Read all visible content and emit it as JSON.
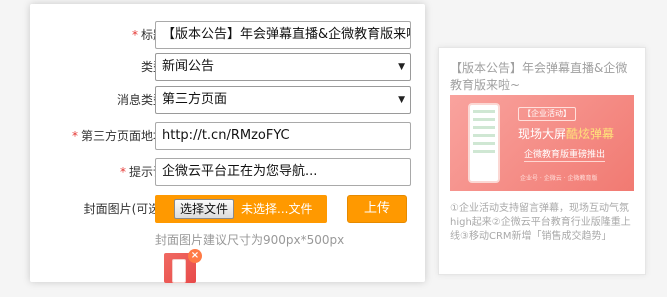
{
  "form": {
    "title": {
      "label": "标题：",
      "value": "【版本公告】年会弹幕直播&企微教育版来啦~"
    },
    "type": {
      "label": "类型：",
      "selected": "新闻公告"
    },
    "message_type": {
      "label": "消息类型：",
      "selected": "第三方页面"
    },
    "third_party_url": {
      "label": "第三方页面地址：",
      "value": "http://t.cn/RMzoFYC"
    },
    "prompt": {
      "label": "提示语：",
      "value": "企微云平台正在为您导航..."
    },
    "cover": {
      "label": "封面图片(可选)：",
      "choose_file": "选择文件",
      "no_file": "未选择...文件",
      "upload": "上传",
      "hint": "封面图片建议尺寸为900px*500px",
      "remove_icon": "close-icon"
    },
    "required_mark": "*"
  },
  "preview": {
    "title": "【版本公告】年会弹幕直播&企微教育版来啦~",
    "banner": {
      "tag": "【企业活动】",
      "main_prefix": "现场大屏",
      "main_highlight": "酷炫弹幕",
      "sub": "企微教育版重磅推出",
      "foot": "企业号 · 企微云 · 企微教育版"
    },
    "description": "①企业活动支持留言弹幕，现场互动气氛high起来②企微云平台教育行业版隆重上线③移动CRM新增「销售成交趋势」"
  },
  "colors": {
    "accent_orange": "#ff9900",
    "required_red": "#e53935",
    "banner_pink": "#f17a72"
  }
}
